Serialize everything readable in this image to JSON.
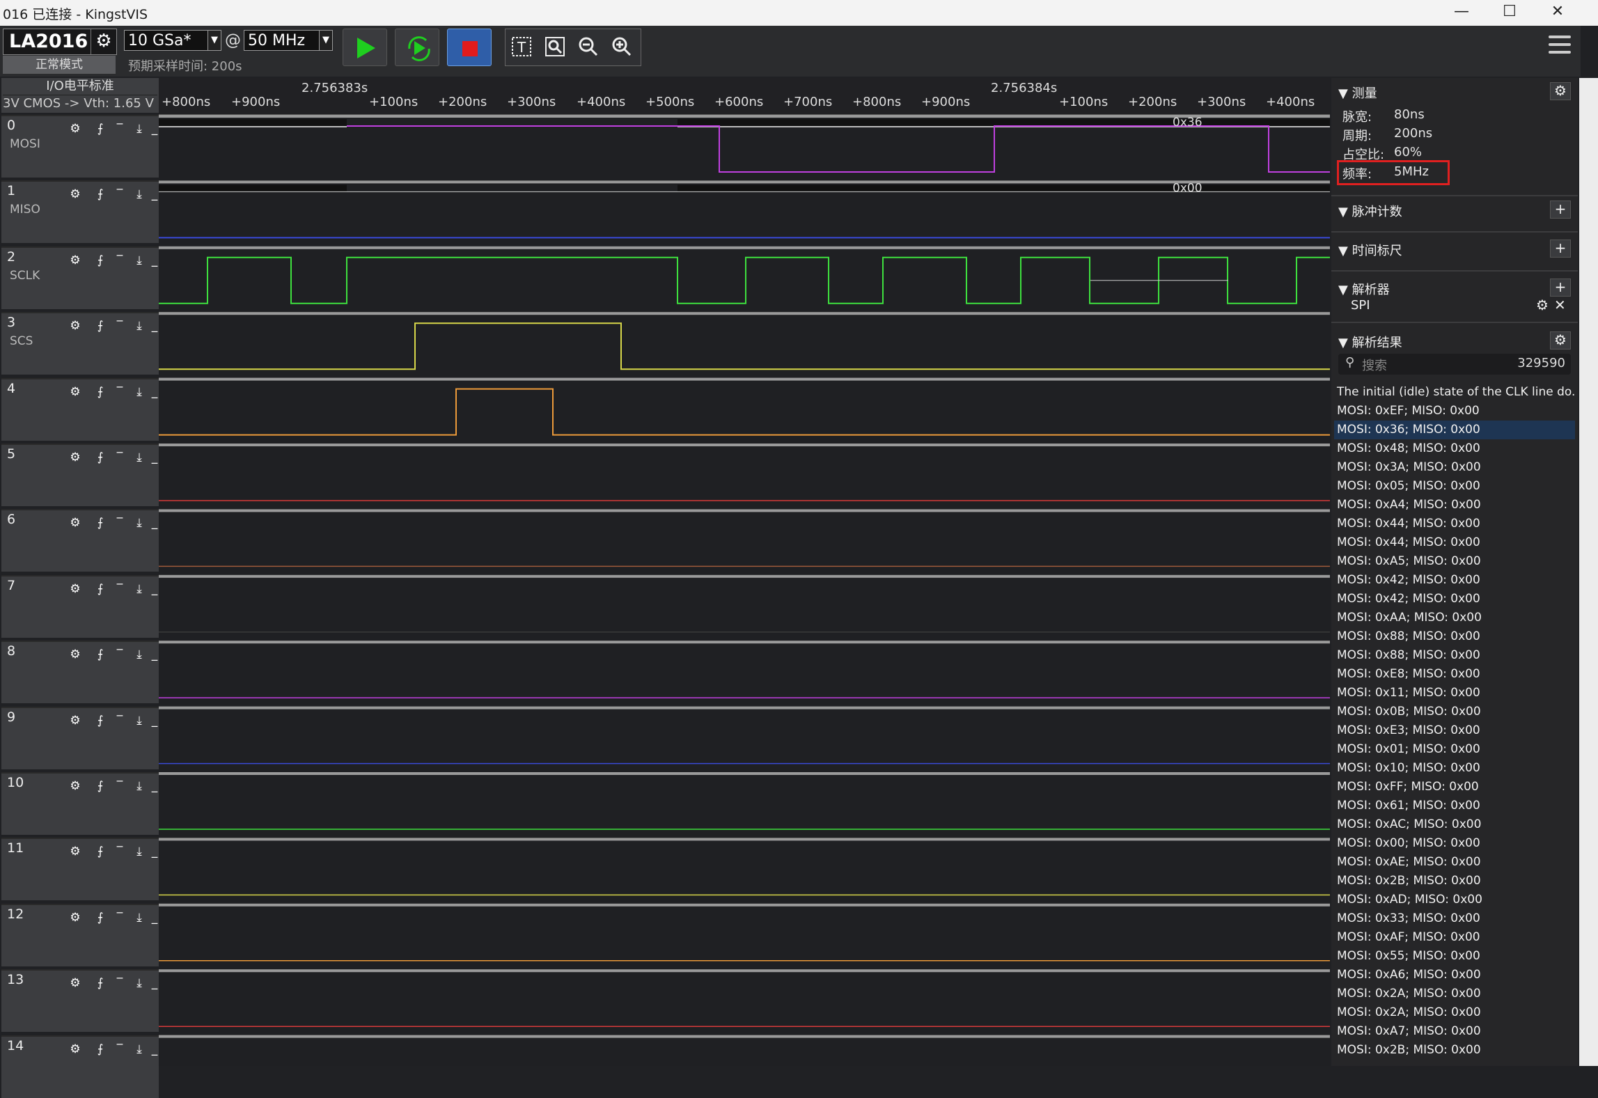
{
  "window": {
    "title": "016 已连接 - KingstVIS",
    "controls": [
      "—",
      "☐",
      "✕"
    ]
  },
  "toolbar": {
    "device": "LA2016",
    "mode": "正常模式",
    "sample_rate": "10 GSa*",
    "at": "@",
    "frequency": "50 MHz",
    "estimate": "预期采样时间: 200s"
  },
  "io_standard": {
    "title": "I/O电平标准",
    "value": "3V CMOS -> Vth: 1.65 V"
  },
  "ruler": {
    "major": [
      {
        "label": "2.756383s"
      },
      {
        "label": "2.756384s"
      }
    ],
    "minor": [
      "+800ns",
      "+900ns",
      "+100ns",
      "+200ns",
      "+300ns",
      "+400ns",
      "+500ns",
      "+600ns",
      "+700ns",
      "+800ns",
      "+900ns",
      "+100ns",
      "+200ns",
      "+300ns",
      "+400ns"
    ]
  },
  "channels": [
    {
      "num": "0",
      "label": "MOSI",
      "color": "#c040e0"
    },
    {
      "num": "1",
      "label": "MISO",
      "color": "#3a4ad8"
    },
    {
      "num": "2",
      "label": "SCLK",
      "color": "#3ee03e"
    },
    {
      "num": "3",
      "label": "SCS",
      "color": "#d8d84a"
    },
    {
      "num": "4",
      "label": "",
      "color": "#ec9a3a"
    },
    {
      "num": "5",
      "label": "",
      "color": "#d83a3a"
    },
    {
      "num": "6",
      "label": "",
      "color": "#a05a3a"
    },
    {
      "num": "7",
      "label": "",
      "color": "#3a3a3a"
    },
    {
      "num": "8",
      "label": "",
      "color": "#c040e0"
    },
    {
      "num": "9",
      "label": "",
      "color": "#3a4ad8"
    },
    {
      "num": "10",
      "label": "",
      "color": "#3ee03e"
    },
    {
      "num": "11",
      "label": "",
      "color": "#d8d84a"
    },
    {
      "num": "12",
      "label": "",
      "color": "#ec9a3a"
    },
    {
      "num": "13",
      "label": "",
      "color": "#d83a3a"
    },
    {
      "num": "14",
      "label": "",
      "color": "#a05a3a"
    }
  ],
  "bus_labels": {
    "mosi": "0x36",
    "miso": "0x00"
  },
  "channel_icons": [
    "gear-icon",
    "rising-edge-icon",
    "high-level-icon",
    "falling-edge-icon",
    "low-level-icon"
  ],
  "panel": {
    "measure": {
      "title": "测量",
      "rows": [
        {
          "k": "脉宽:",
          "v": "80ns"
        },
        {
          "k": "周期:",
          "v": "200ns"
        },
        {
          "k": "占空比:",
          "v": "60%"
        },
        {
          "k": "频率:",
          "v": "5MHz"
        }
      ]
    },
    "pulse_count": "脉冲计数",
    "time_ruler": "时间标尺",
    "analyzer": {
      "title": "解析器",
      "item": "SPI"
    },
    "results": {
      "title": "解析结果",
      "search_placeholder": "搜索",
      "count": "329590",
      "items": [
        "The initial (idle) state of the CLK line do...",
        "MOSI: 0xEF;  MISO: 0x00",
        "MOSI: 0x36;  MISO: 0x00",
        "MOSI: 0x48;  MISO: 0x00",
        "MOSI: 0x3A;  MISO: 0x00",
        "MOSI: 0x05;  MISO: 0x00",
        "MOSI: 0xA4;  MISO: 0x00",
        "MOSI: 0x44;  MISO: 0x00",
        "MOSI: 0x44;  MISO: 0x00",
        "MOSI: 0xA5;  MISO: 0x00",
        "MOSI: 0x42;  MISO: 0x00",
        "MOSI: 0x42;  MISO: 0x00",
        "MOSI: 0xAA;  MISO: 0x00",
        "MOSI: 0x88;  MISO: 0x00",
        "MOSI: 0x88;  MISO: 0x00",
        "MOSI: 0xE8;  MISO: 0x00",
        "MOSI: 0x11;  MISO: 0x00",
        "MOSI: 0x0B;  MISO: 0x00",
        "MOSI: 0xE3;  MISO: 0x00",
        "MOSI: 0x01;  MISO: 0x00",
        "MOSI: 0x10;  MISO: 0x00",
        "MOSI: 0xFF;  MISO: 0x00",
        "MOSI: 0x61;  MISO: 0x00",
        "MOSI: 0xAC;  MISO: 0x00",
        "MOSI: 0x00;  MISO: 0x00",
        "MOSI: 0xAE;  MISO: 0x00",
        "MOSI: 0x2B;  MISO: 0x00",
        "MOSI: 0xAD;  MISO: 0x00",
        "MOSI: 0x33;  MISO: 0x00",
        "MOSI: 0xAF;  MISO: 0x00",
        "MOSI: 0x55;  MISO: 0x00",
        "MOSI: 0xA6;  MISO: 0x00",
        "MOSI: 0x2A;  MISO: 0x00",
        "MOSI: 0x2A;  MISO: 0x00",
        "MOSI: 0xA7;  MISO: 0x00",
        "MOSI: 0x2B;  MISO: 0x00"
      ]
    }
  }
}
